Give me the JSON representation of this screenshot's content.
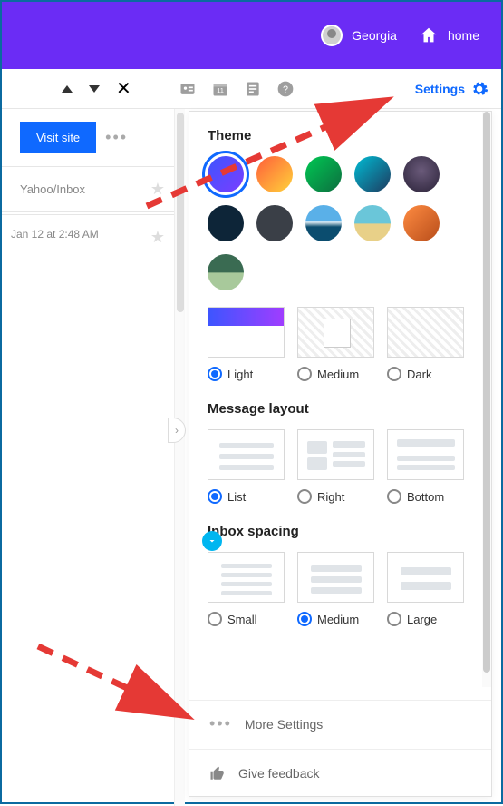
{
  "header": {
    "user_name": "Georgia",
    "home_label": "home"
  },
  "toolbar": {
    "settings_label": "Settings"
  },
  "left": {
    "visit_button": "Visit site",
    "folder": "Yahoo/Inbox",
    "timestamp": "Jan 12 at 2:48 AM"
  },
  "panel": {
    "theme_heading": "Theme",
    "theme_options": {
      "light": "Light",
      "medium": "Medium",
      "dark": "Dark"
    },
    "theme_selected": "light",
    "layout_heading": "Message layout",
    "layout_options": {
      "list": "List",
      "right": "Right",
      "bottom": "Bottom"
    },
    "layout_selected": "list",
    "spacing_heading": "Inbox spacing",
    "spacing_options": {
      "small": "Small",
      "medium": "Medium",
      "large": "Large"
    },
    "spacing_selected": "medium",
    "more_settings": "More Settings",
    "feedback": "Give feedback"
  }
}
